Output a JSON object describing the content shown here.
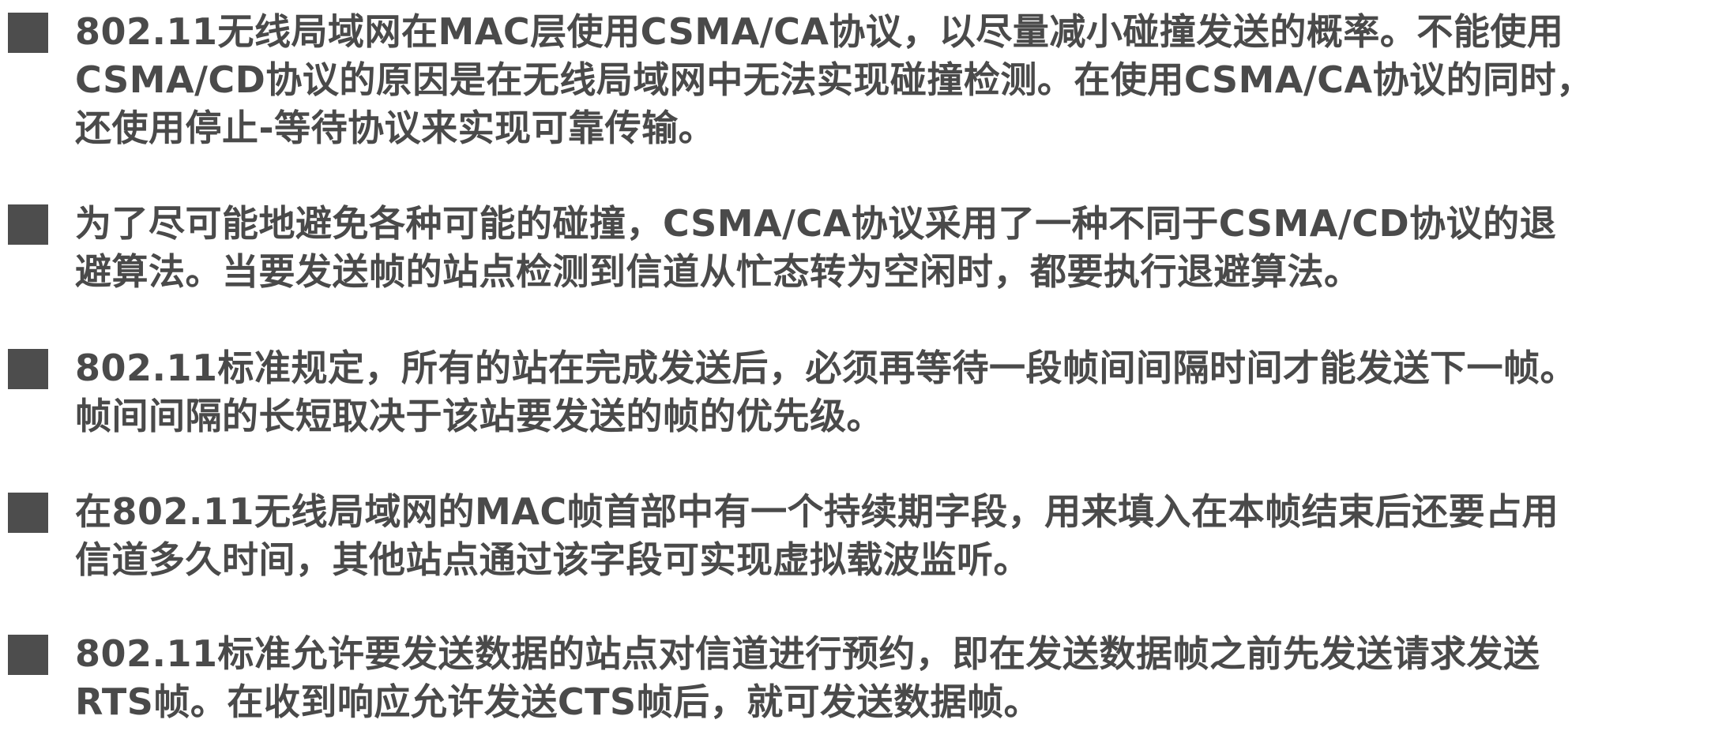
{
  "bullets": [
    {
      "lines": [
        "802.11无线局域网在MAC层使用CSMA/CA协议，以尽量减小碰撞发送的概率。不能使用",
        "CSMA/CD协议的原因是在无线局域网中无法实现碰撞检测。在使用CSMA/CA协议的同时，",
        "还使用停止-等待协议来实现可靠传输。"
      ]
    },
    {
      "lines": [
        "为了尽可能地避免各种可能的碰撞，CSMA/CA协议采用了一种不同于CSMA/CD协议的退",
        "避算法。当要发送帧的站点检测到信道从忙态转为空闲时，都要执行退避算法。"
      ]
    },
    {
      "lines": [
        "802.11标准规定，所有的站在完成发送后，必须再等待一段帧间间隔时间才能发送下一帧。",
        "帧间间隔的长短取决于该站要发送的帧的优先级。"
      ]
    },
    {
      "lines": [
        "在802.11无线局域网的MAC帧首部中有一个持续期字段，用来填入在本帧结束后还要占用",
        "信道多久时间，其他站点通过该字段可实现虚拟载波监听。"
      ]
    },
    {
      "lines": [
        "802.11标准允许要发送数据的站点对信道进行预约，即在发送数据帧之前先发送请求发送",
        "RTS帧。在收到响应允许发送CTS帧后，就可发送数据帧。"
      ]
    }
  ]
}
